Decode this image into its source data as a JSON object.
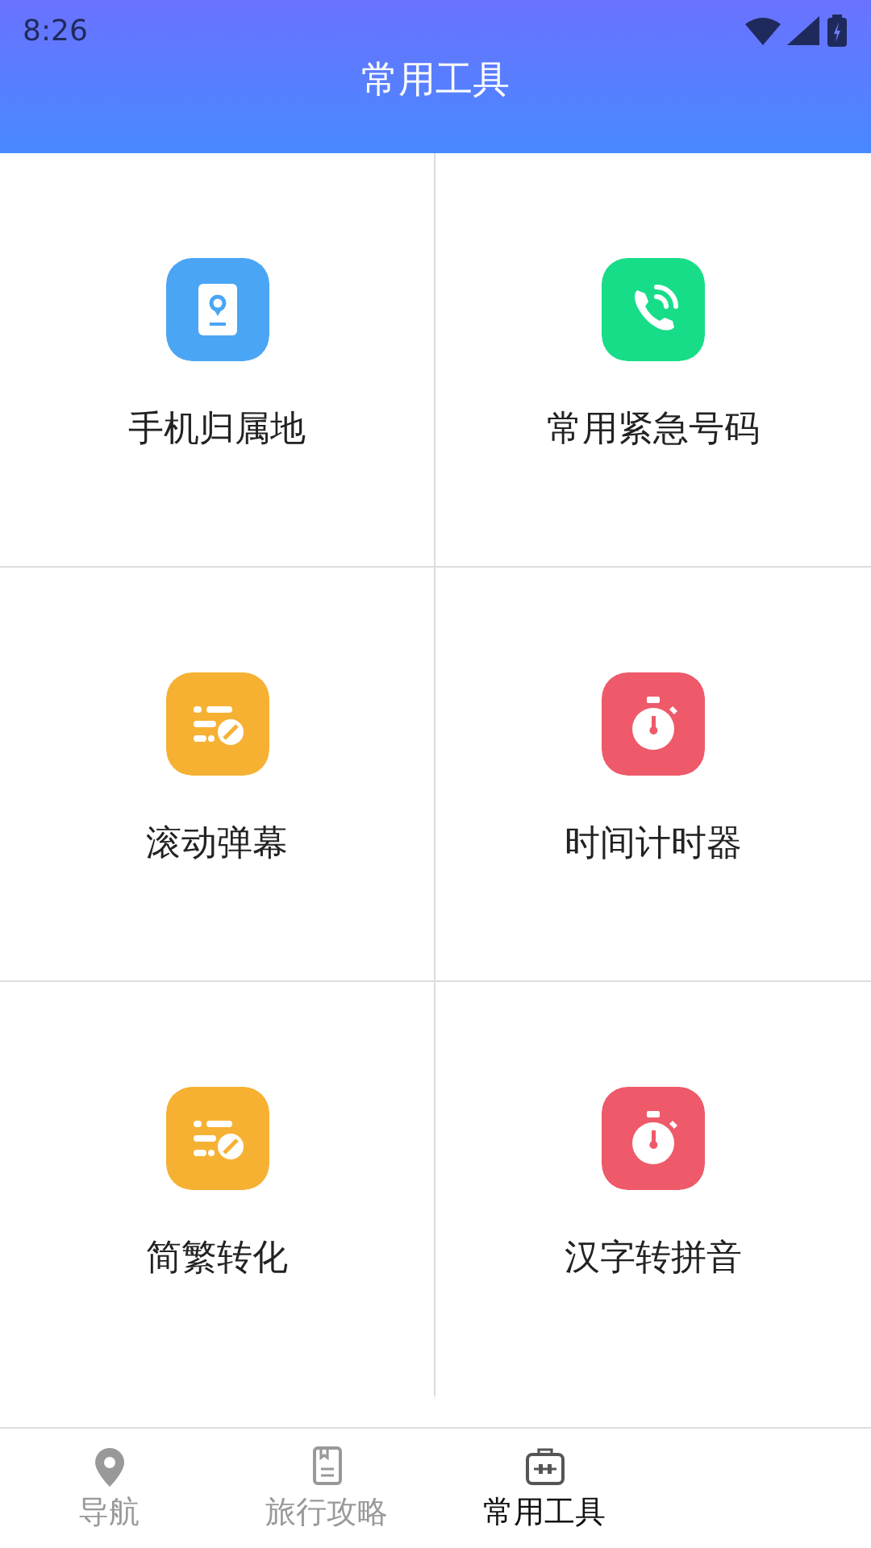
{
  "status_bar": {
    "time": "8:26"
  },
  "header": {
    "title": "常用工具"
  },
  "tools": [
    {
      "label": "手机归属地",
      "kind": "location-card",
      "color": "#4aa6f5"
    },
    {
      "label": "常用紧急号码",
      "kind": "phone",
      "color": "#18dd88"
    },
    {
      "label": "滚动弹幕",
      "kind": "list-edit",
      "color": "#f6b133"
    },
    {
      "label": "时间计时器",
      "kind": "stopwatch",
      "color": "#ee5a6a"
    },
    {
      "label": "简繁转化",
      "kind": "list-edit",
      "color": "#f6b133"
    },
    {
      "label": "汉字转拼音",
      "kind": "stopwatch",
      "color": "#ee5a6a"
    }
  ],
  "bottom_nav": [
    {
      "label": "导航",
      "kind": "pin",
      "selected": false
    },
    {
      "label": "旅行攻略",
      "kind": "book",
      "selected": false
    },
    {
      "label": "常用工具",
      "kind": "toolbox",
      "selected": true
    }
  ]
}
